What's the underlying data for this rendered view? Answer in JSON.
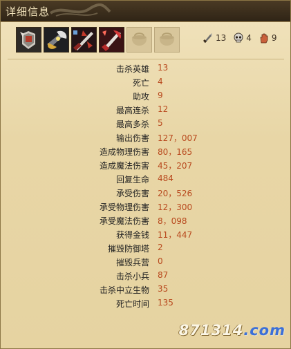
{
  "header": {
    "title": "详细信息"
  },
  "items": [
    {
      "name": "armor-item-icon",
      "empty": false
    },
    {
      "name": "axe-item-icon",
      "empty": false
    },
    {
      "name": "sword-item-icon",
      "empty": false
    },
    {
      "name": "blade-item-icon",
      "empty": false
    },
    {
      "name": "empty-bag-slot-icon",
      "empty": true
    },
    {
      "name": "empty-bag-slot-icon",
      "empty": true
    }
  ],
  "kda": {
    "kills": "13",
    "deaths": "4",
    "assists": "9"
  },
  "stats": [
    {
      "label": "击杀英雄",
      "value": "13"
    },
    {
      "label": "死亡",
      "value": "4"
    },
    {
      "label": "助攻",
      "value": "9"
    },
    {
      "label": "最高连杀",
      "value": "12"
    },
    {
      "label": "最高多杀",
      "value": "5"
    },
    {
      "label": "输出伤害",
      "value": "127，007"
    },
    {
      "label": "造成物理伤害",
      "value": "80，165"
    },
    {
      "label": "造成魔法伤害",
      "value": "45，207"
    },
    {
      "label": "回复生命",
      "value": "484"
    },
    {
      "label": "承受伤害",
      "value": "20，526"
    },
    {
      "label": "承受物理伤害",
      "value": "12，300"
    },
    {
      "label": "承受魔法伤害",
      "value": "8，098"
    },
    {
      "label": "获得金钱",
      "value": "11，447"
    },
    {
      "label": "摧毁防御塔",
      "value": "2"
    },
    {
      "label": "摧毁兵营",
      "value": "0"
    },
    {
      "label": "击杀小兵",
      "value": "87"
    },
    {
      "label": "击杀中立生物",
      "value": "35"
    },
    {
      "label": "死亡时间",
      "value": "135"
    }
  ],
  "watermark": {
    "number": "871314",
    "domain": ".com"
  },
  "colors": {
    "value_text": "#b8481d",
    "title_bar": "#2f2416",
    "panel_bg": "#e8d6a6"
  }
}
